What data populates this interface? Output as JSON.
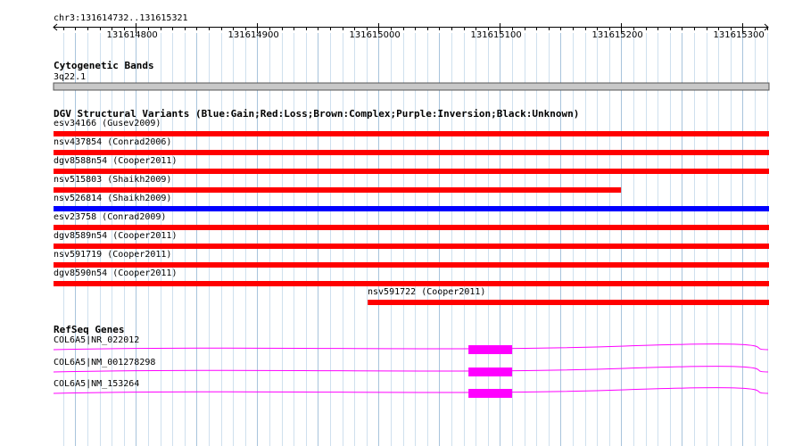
{
  "location": "chr3:131614732..131615321",
  "ruler": {
    "start": 131614732,
    "end": 131615321,
    "labels": [
      "131614800",
      "131614900",
      "131615000",
      "131615100",
      "131615200",
      "131615300"
    ],
    "label_values": [
      131614800,
      131614900,
      131615000,
      131615100,
      131615200,
      131615300
    ]
  },
  "tracks": {
    "cytoband": {
      "title": "Cytogenetic Bands",
      "band": "3q22.1"
    },
    "dgv": {
      "title": "DGV Structural Variants (Blue:Gain;Red:Loss;Brown:Complex;Purple:Inversion;Black:Unknown)",
      "variants": [
        {
          "id": "esv34166",
          "label": "esv34166 (Gusev2009)",
          "type": "Loss",
          "color": "#ff0000",
          "start": 131614732,
          "end": 131615321
        },
        {
          "id": "nsv437854",
          "label": "nsv437854 (Conrad2006)",
          "type": "Loss",
          "color": "#ff0000",
          "start": 131614732,
          "end": 131615321
        },
        {
          "id": "dgv8588n54",
          "label": "dgv8588n54 (Cooper2011)",
          "type": "Loss",
          "color": "#ff0000",
          "start": 131614732,
          "end": 131615321
        },
        {
          "id": "nsv515803",
          "label": "nsv515803 (Shaikh2009)",
          "type": "Loss",
          "color": "#ff0000",
          "start": 131614732,
          "end": 131615199
        },
        {
          "id": "nsv526814",
          "label": "nsv526814 (Shaikh2009)",
          "type": "Gain",
          "color": "#0000ff",
          "start": 131614732,
          "end": 131615321
        },
        {
          "id": "esv23758",
          "label": "esv23758 (Conrad2009)",
          "type": "Loss",
          "color": "#ff0000",
          "start": 131614732,
          "end": 131615321
        },
        {
          "id": "dgv8589n54",
          "label": "dgv8589n54 (Cooper2011)",
          "type": "Loss",
          "color": "#ff0000",
          "start": 131614732,
          "end": 131615321
        },
        {
          "id": "nsv591719",
          "label": "nsv591719 (Cooper2011)",
          "type": "Loss",
          "color": "#ff0000",
          "start": 131614732,
          "end": 131615321
        },
        {
          "id": "dgv8590n54",
          "label": "dgv8590n54 (Cooper2011)",
          "type": "Loss",
          "color": "#ff0000",
          "start": 131614732,
          "end": 131615321
        },
        {
          "id": "nsv591722",
          "label": "nsv591722 (Cooper2011)",
          "type": "Loss",
          "color": "#ff0000",
          "start": 131614991,
          "end": 131615321
        }
      ]
    },
    "refseq": {
      "title": "RefSeq Genes",
      "color": "#ff00ff",
      "genes": [
        {
          "label": "COL6A5|NR_022012",
          "exon_start": 131615074,
          "exon_end": 131615110
        },
        {
          "label": "COL6A5|NM_001278298",
          "exon_start": 131615074,
          "exon_end": 131615110
        },
        {
          "label": "COL6A5|NM_153264",
          "exon_start": 131615074,
          "exon_end": 131615110
        }
      ]
    }
  }
}
